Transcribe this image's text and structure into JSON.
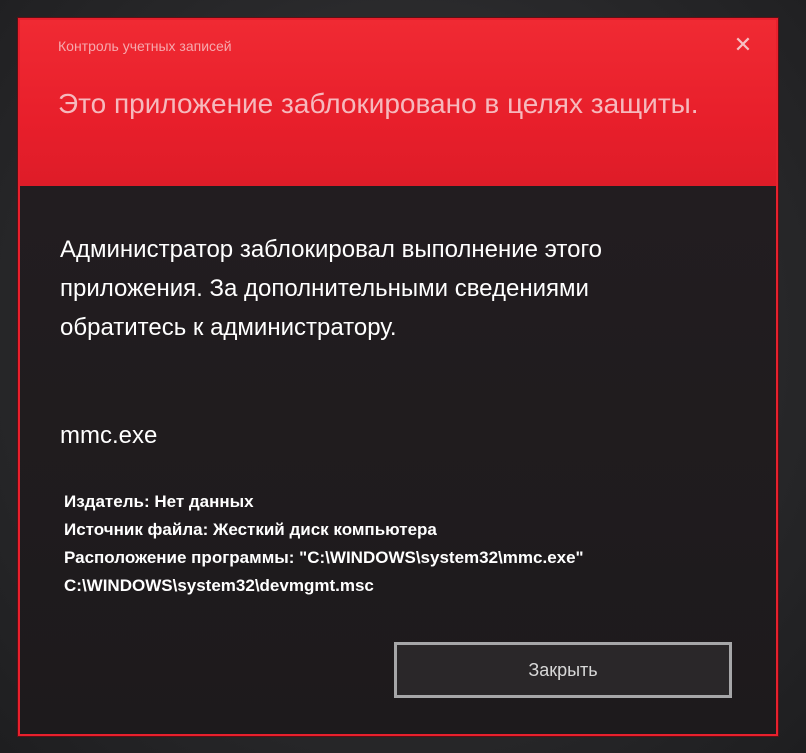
{
  "dialog": {
    "window_title": "Контроль учетных записей",
    "headline": "Это приложение заблокировано в целях защиты.",
    "message": "Администратор заблокировал выполнение этого приложения. За дополнительными сведениями обратитесь к администратору.",
    "exe_name": "mmc.exe",
    "details": {
      "publisher": "Издатель: Нет данных",
      "source": "Источник файла: Жесткий диск компьютера",
      "location_line1": "Расположение программы: \"C:\\WINDOWS\\system32\\mmc.exe\"",
      "location_line2": "C:\\WINDOWS\\system32\\devmgmt.msc"
    },
    "close_button_label": "Закрыть",
    "close_icon": "close-x-icon",
    "colors": {
      "accent_red": "#e81f2b",
      "body_bg": "#1f1b1d",
      "text": "#ffffff"
    }
  }
}
